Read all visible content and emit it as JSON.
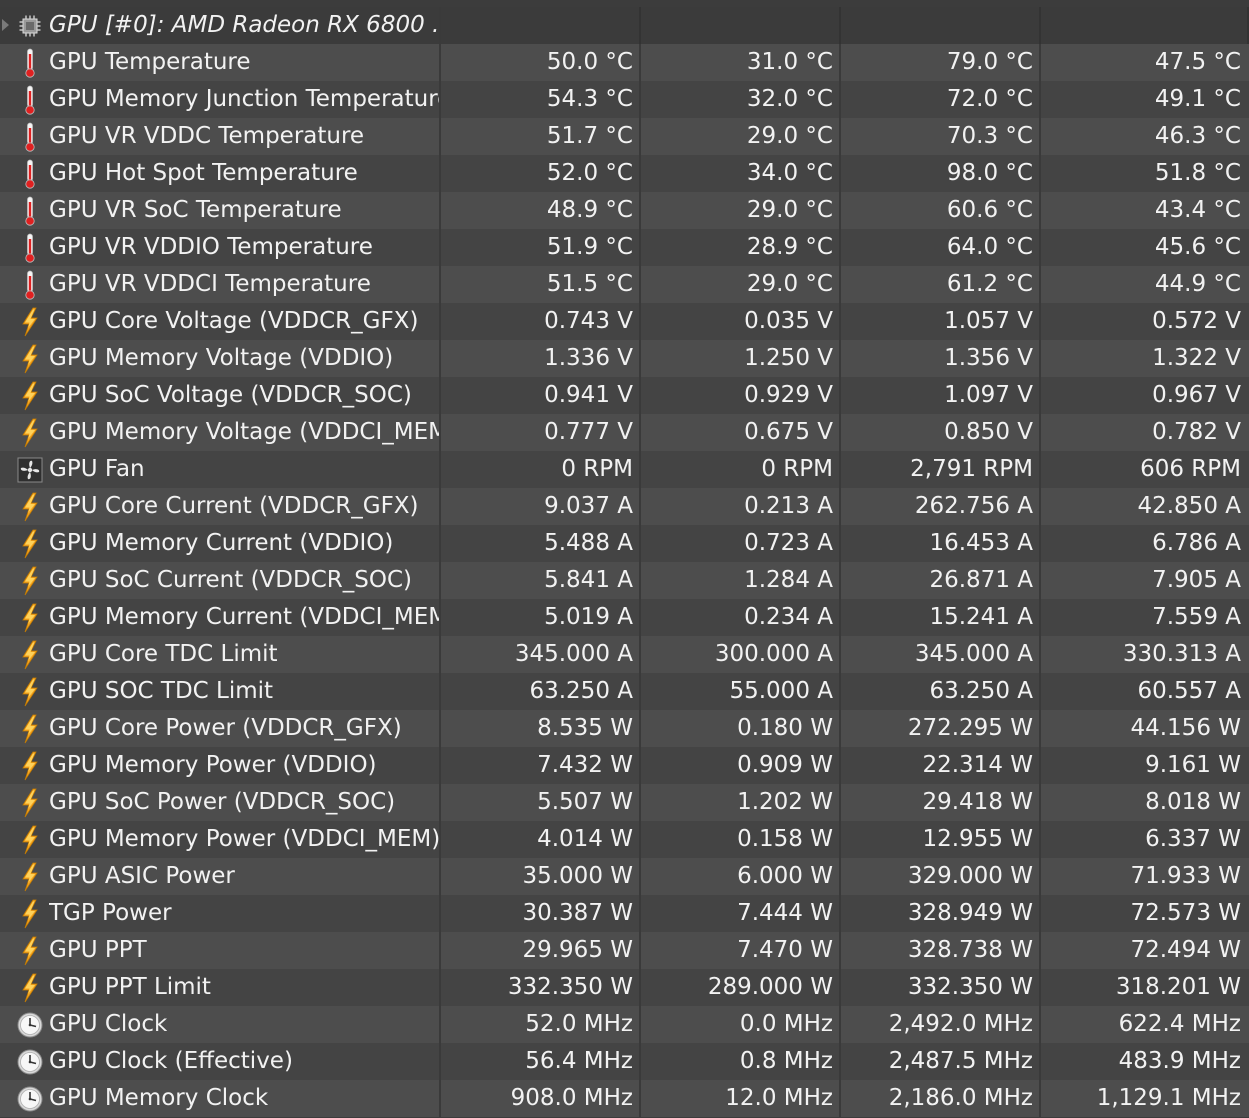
{
  "group": {
    "title": "GPU [#0]: AMD Radeon RX 6800 ...",
    "icon": "chip-icon"
  },
  "rows": [
    {
      "icon": "thermometer-icon",
      "name": "GPU Temperature",
      "current": "50.0 °C",
      "min": "31.0 °C",
      "max": "79.0 °C",
      "avg": "47.5 °C"
    },
    {
      "icon": "thermometer-icon",
      "name": "GPU Memory Junction Temperature",
      "current": "54.3 °C",
      "min": "32.0 °C",
      "max": "72.0 °C",
      "avg": "49.1 °C"
    },
    {
      "icon": "thermometer-icon",
      "name": "GPU VR VDDC Temperature",
      "current": "51.7 °C",
      "min": "29.0 °C",
      "max": "70.3 °C",
      "avg": "46.3 °C"
    },
    {
      "icon": "thermometer-icon",
      "name": "GPU Hot Spot Temperature",
      "current": "52.0 °C",
      "min": "34.0 °C",
      "max": "98.0 °C",
      "avg": "51.8 °C"
    },
    {
      "icon": "thermometer-icon",
      "name": "GPU VR SoC Temperature",
      "current": "48.9 °C",
      "min": "29.0 °C",
      "max": "60.6 °C",
      "avg": "43.4 °C"
    },
    {
      "icon": "thermometer-icon",
      "name": "GPU VR VDDIO Temperature",
      "current": "51.9 °C",
      "min": "28.9 °C",
      "max": "64.0 °C",
      "avg": "45.6 °C"
    },
    {
      "icon": "thermometer-icon",
      "name": "GPU VR VDDCI Temperature",
      "current": "51.5 °C",
      "min": "29.0 °C",
      "max": "61.2 °C",
      "avg": "44.9 °C"
    },
    {
      "icon": "lightning-icon",
      "name": "GPU Core Voltage (VDDCR_GFX)",
      "current": "0.743 V",
      "min": "0.035 V",
      "max": "1.057 V",
      "avg": "0.572 V"
    },
    {
      "icon": "lightning-icon",
      "name": "GPU Memory Voltage (VDDIO)",
      "current": "1.336 V",
      "min": "1.250 V",
      "max": "1.356 V",
      "avg": "1.322 V"
    },
    {
      "icon": "lightning-icon",
      "name": "GPU SoC Voltage (VDDCR_SOC)",
      "current": "0.941 V",
      "min": "0.929 V",
      "max": "1.097 V",
      "avg": "0.967 V"
    },
    {
      "icon": "lightning-icon",
      "name": "GPU Memory Voltage (VDDCI_MEM)",
      "current": "0.777 V",
      "min": "0.675 V",
      "max": "0.850 V",
      "avg": "0.782 V"
    },
    {
      "icon": "fan-icon",
      "name": "GPU Fan",
      "current": "0 RPM",
      "min": "0 RPM",
      "max": "2,791 RPM",
      "avg": "606 RPM"
    },
    {
      "icon": "lightning-icon",
      "name": "GPU Core Current (VDDCR_GFX)",
      "current": "9.037 A",
      "min": "0.213 A",
      "max": "262.756 A",
      "avg": "42.850 A"
    },
    {
      "icon": "lightning-icon",
      "name": "GPU Memory Current (VDDIO)",
      "current": "5.488 A",
      "min": "0.723 A",
      "max": "16.453 A",
      "avg": "6.786 A"
    },
    {
      "icon": "lightning-icon",
      "name": "GPU SoC Current (VDDCR_SOC)",
      "current": "5.841 A",
      "min": "1.284 A",
      "max": "26.871 A",
      "avg": "7.905 A"
    },
    {
      "icon": "lightning-icon",
      "name": "GPU Memory Current (VDDCI_MEM)",
      "current": "5.019 A",
      "min": "0.234 A",
      "max": "15.241 A",
      "avg": "7.559 A"
    },
    {
      "icon": "lightning-icon",
      "name": "GPU Core TDC Limit",
      "current": "345.000 A",
      "min": "300.000 A",
      "max": "345.000 A",
      "avg": "330.313 A"
    },
    {
      "icon": "lightning-icon",
      "name": "GPU SOC TDC Limit",
      "current": "63.250 A",
      "min": "55.000 A",
      "max": "63.250 A",
      "avg": "60.557 A"
    },
    {
      "icon": "lightning-icon",
      "name": "GPU Core Power (VDDCR_GFX)",
      "current": "8.535 W",
      "min": "0.180 W",
      "max": "272.295 W",
      "avg": "44.156 W"
    },
    {
      "icon": "lightning-icon",
      "name": "GPU Memory Power (VDDIO)",
      "current": "7.432 W",
      "min": "0.909 W",
      "max": "22.314 W",
      "avg": "9.161 W"
    },
    {
      "icon": "lightning-icon",
      "name": "GPU SoC Power (VDDCR_SOC)",
      "current": "5.507 W",
      "min": "1.202 W",
      "max": "29.418 W",
      "avg": "8.018 W"
    },
    {
      "icon": "lightning-icon",
      "name": "GPU Memory Power (VDDCI_MEM)",
      "current": "4.014 W",
      "min": "0.158 W",
      "max": "12.955 W",
      "avg": "6.337 W"
    },
    {
      "icon": "lightning-icon",
      "name": "GPU ASIC Power",
      "current": "35.000 W",
      "min": "6.000 W",
      "max": "329.000 W",
      "avg": "71.933 W"
    },
    {
      "icon": "lightning-icon",
      "name": "TGP Power",
      "current": "30.387 W",
      "min": "7.444 W",
      "max": "328.949 W",
      "avg": "72.573 W"
    },
    {
      "icon": "lightning-icon",
      "name": "GPU PPT",
      "current": "29.965 W",
      "min": "7.470 W",
      "max": "328.738 W",
      "avg": "72.494 W"
    },
    {
      "icon": "lightning-icon",
      "name": "GPU PPT Limit",
      "current": "332.350 W",
      "min": "289.000 W",
      "max": "332.350 W",
      "avg": "318.201 W"
    },
    {
      "icon": "clock-icon",
      "name": "GPU Clock",
      "current": "52.0 MHz",
      "min": "0.0 MHz",
      "max": "2,492.0 MHz",
      "avg": "622.4 MHz"
    },
    {
      "icon": "clock-icon",
      "name": "GPU Clock (Effective)",
      "current": "56.4 MHz",
      "min": "0.8 MHz",
      "max": "2,487.5 MHz",
      "avg": "483.9 MHz"
    },
    {
      "icon": "clock-icon",
      "name": "GPU Memory Clock",
      "current": "908.0 MHz",
      "min": "12.0 MHz",
      "max": "2,186.0 MHz",
      "avg": "1,129.1 MHz"
    }
  ],
  "colors": {
    "row_even": "#4d4d4d",
    "row_odd": "#444444",
    "text": "#f2f2f2",
    "thermometer_red": "#e02020",
    "lightning_orange": "#f5a623"
  }
}
